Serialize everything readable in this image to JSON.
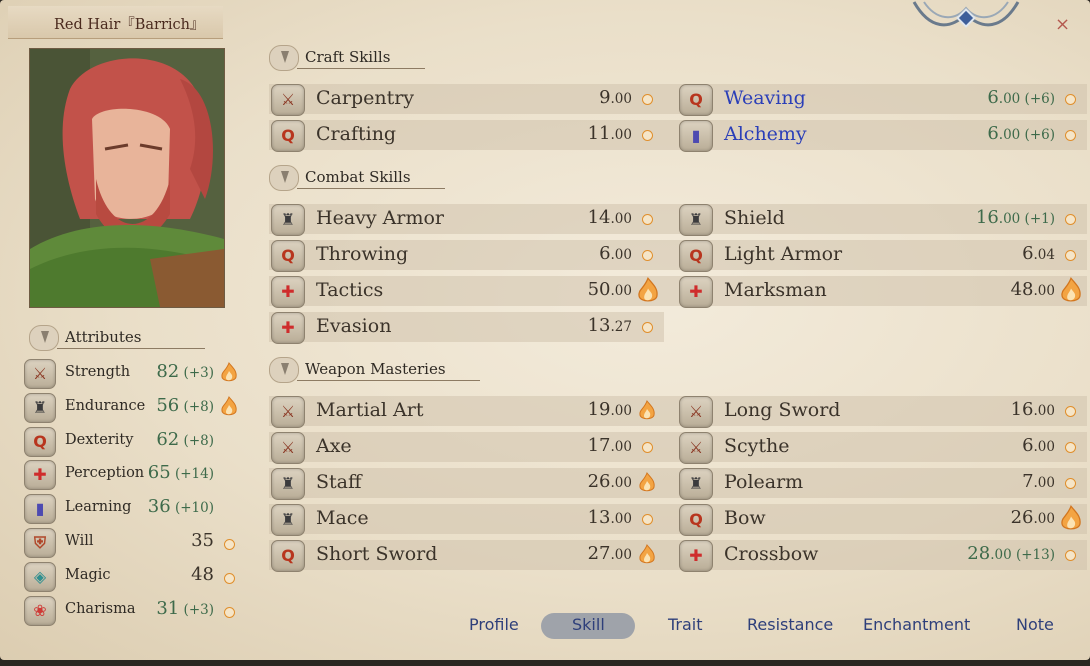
{
  "window": {
    "title": "Red Hair『Barrich』",
    "close_glyph": "×"
  },
  "sections": {
    "craft": "Craft Skills",
    "combat": "Combat Skills",
    "weapon": "Weapon Masteries",
    "attributes": "Attributes"
  },
  "craft_skills": [
    {
      "name": "Carpentry",
      "icon": "crossed-swords-icon",
      "value": "9",
      "decimal": ".00",
      "bonus": "",
      "indicator": "dot",
      "highlight": false
    },
    {
      "name": "Weaving",
      "icon": "q-ring-icon",
      "value": "6",
      "decimal": ".00",
      "bonus": " (+6)",
      "indicator": "dot",
      "highlight": true
    },
    {
      "name": "Crafting",
      "icon": "q-ring-icon",
      "value": "11",
      "decimal": ".00",
      "bonus": "",
      "indicator": "dot",
      "highlight": false
    },
    {
      "name": "Alchemy",
      "icon": "book-icon",
      "value": "6",
      "decimal": ".00",
      "bonus": " (+6)",
      "indicator": "dot",
      "highlight": true
    }
  ],
  "combat_skills": [
    {
      "name": "Heavy Armor",
      "icon": "armor-icon",
      "value": "14",
      "decimal": ".00",
      "bonus": "",
      "indicator": "dot"
    },
    {
      "name": "Shield",
      "icon": "armor-icon",
      "value": "16",
      "decimal": ".00",
      "bonus": " (+1)",
      "indicator": "dot"
    },
    {
      "name": "Throwing",
      "icon": "q-ring-icon",
      "value": "6",
      "decimal": ".00",
      "bonus": "",
      "indicator": "dot"
    },
    {
      "name": "Light Armor",
      "icon": "q-ring-icon",
      "value": "6",
      "decimal": ".04",
      "bonus": "",
      "indicator": "dot"
    },
    {
      "name": "Tactics",
      "icon": "cross-dots-icon",
      "value": "50",
      "decimal": ".00",
      "bonus": "",
      "indicator": "flame-big"
    },
    {
      "name": "Marksman",
      "icon": "cross-dots-icon",
      "value": "48",
      "decimal": ".00",
      "bonus": "",
      "indicator": "flame-big"
    },
    {
      "name": "Evasion",
      "icon": "cross-dots-icon",
      "value": "13",
      "decimal": ".27",
      "bonus": "",
      "indicator": "dot"
    }
  ],
  "weapon_masteries": [
    {
      "name": "Martial Art",
      "icon": "crossed-swords-icon",
      "value": "19",
      "decimal": ".00",
      "bonus": "",
      "indicator": "flame"
    },
    {
      "name": "Long Sword",
      "icon": "crossed-swords-icon",
      "value": "16",
      "decimal": ".00",
      "bonus": "",
      "indicator": "dot"
    },
    {
      "name": "Axe",
      "icon": "crossed-swords-icon",
      "value": "17",
      "decimal": ".00",
      "bonus": "",
      "indicator": "dot"
    },
    {
      "name": "Scythe",
      "icon": "crossed-swords-icon",
      "value": "6",
      "decimal": ".00",
      "bonus": "",
      "indicator": "dot"
    },
    {
      "name": "Staff",
      "icon": "armor-icon",
      "value": "26",
      "decimal": ".00",
      "bonus": "",
      "indicator": "flame"
    },
    {
      "name": "Polearm",
      "icon": "armor-icon",
      "value": "7",
      "decimal": ".00",
      "bonus": "",
      "indicator": "dot"
    },
    {
      "name": "Mace",
      "icon": "armor-icon",
      "value": "13",
      "decimal": ".00",
      "bonus": "",
      "indicator": "dot"
    },
    {
      "name": "Bow",
      "icon": "q-ring-icon",
      "value": "26",
      "decimal": ".00",
      "bonus": "",
      "indicator": "flame-big"
    },
    {
      "name": "Short Sword",
      "icon": "q-ring-icon",
      "value": "27",
      "decimal": ".00",
      "bonus": "",
      "indicator": "flame"
    },
    {
      "name": "Crossbow",
      "icon": "cross-dots-icon",
      "value": "28",
      "decimal": ".00",
      "bonus": " (+13)",
      "indicator": "dot"
    }
  ],
  "attributes": [
    {
      "name": "Strength",
      "icon": "crossed-swords-icon",
      "value": "82",
      "bonus": " (+3)",
      "indicator": "flame"
    },
    {
      "name": "Endurance",
      "icon": "armor-icon",
      "value": "56",
      "bonus": " (+8)",
      "indicator": "flame"
    },
    {
      "name": "Dexterity",
      "icon": "q-ring-icon",
      "value": "62",
      "bonus": " (+8)",
      "indicator": "none"
    },
    {
      "name": "Perception",
      "icon": "cross-dots-icon",
      "value": "65",
      "bonus": " (+14)",
      "indicator": "none"
    },
    {
      "name": "Learning",
      "icon": "book-icon",
      "value": "36",
      "bonus": " (+10)",
      "indicator": "none"
    },
    {
      "name": "Will",
      "icon": "shield-icon",
      "value": "35",
      "bonus": "",
      "indicator": "dot"
    },
    {
      "name": "Magic",
      "icon": "magic-icon",
      "value": "48",
      "bonus": "",
      "indicator": "dot"
    },
    {
      "name": "Charisma",
      "icon": "bow-ribbon-icon",
      "value": "31",
      "bonus": " (+3)",
      "indicator": "dot"
    }
  ],
  "tabs": [
    {
      "label": "Profile",
      "active": false
    },
    {
      "label": "Skill",
      "active": true
    },
    {
      "label": "Trait",
      "active": false
    },
    {
      "label": "Resistance",
      "active": false
    },
    {
      "label": "Enchantment",
      "active": false
    },
    {
      "label": "Note",
      "active": false
    }
  ]
}
